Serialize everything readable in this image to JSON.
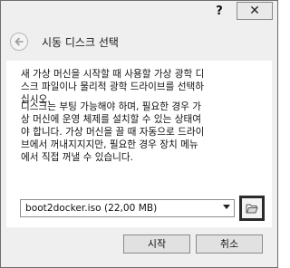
{
  "titlebar": {
    "help_label": "?",
    "close_label": "✕"
  },
  "header": {
    "title": "시동 디스크 선택"
  },
  "main": {
    "paragraph1": "새 가상 머신을 시작할 때 사용할 가상 광학 디\n스크 파일이나 물리적 광학 드라이브를 선택하\n십시오.",
    "paragraph2": "디스크는 부팅 가능해야 하며, 필요한 경우 가\n상 머신에 운영 체제를 설치할 수 있는 상태여\n야 합니다. 가상 머신을 끌 때 자동으로 드라이\n브에서 꺼내지지지만, 필요한 경우 장치 메뉴\n에서 직접 꺼낼 수 있습니다.",
    "disk_select": {
      "selected": "boot2docker.iso (22,00 MB)"
    },
    "folder_button_icon": "folder-open-icon"
  },
  "footer": {
    "start_label": "시작",
    "cancel_label": "취소"
  }
}
